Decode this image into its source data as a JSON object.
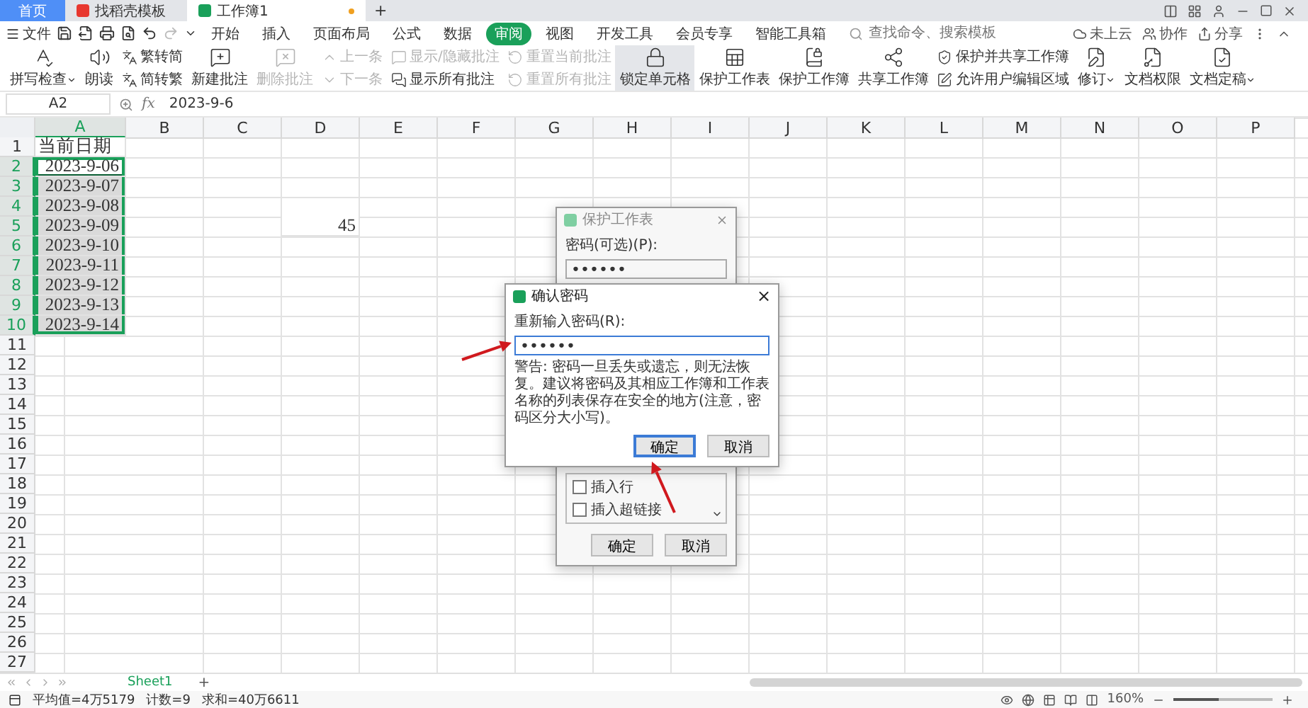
{
  "title_bar": {
    "tabs": [
      {
        "label": "首页",
        "kind": "home",
        "selected": false
      },
      {
        "label": "找稻壳模板",
        "kind": "template",
        "selected": false
      },
      {
        "label": "工作簿1",
        "kind": "sheet",
        "selected": true
      }
    ],
    "new_tab": "+"
  },
  "menu": {
    "file": "文件",
    "tabs": [
      {
        "label": "开始",
        "selected": false
      },
      {
        "label": "插入",
        "selected": false
      },
      {
        "label": "页面布局",
        "selected": false
      },
      {
        "label": "公式",
        "selected": false
      },
      {
        "label": "数据",
        "selected": false
      },
      {
        "label": "审阅",
        "selected": true
      },
      {
        "label": "视图",
        "selected": false
      },
      {
        "label": "开发工具",
        "selected": false
      },
      {
        "label": "会员专享",
        "selected": false
      },
      {
        "label": "智能工具箱",
        "selected": false
      }
    ],
    "search": {
      "placeholder": "查找命令、搜索模板"
    },
    "actions": [
      "未上云",
      "协作",
      "分享"
    ]
  },
  "ribbon": [
    {
      "kind": "large",
      "label": "拼写检查",
      "disabled": false,
      "dropdown": true,
      "selected": false
    },
    {
      "kind": "large",
      "label": "朗读",
      "disabled": false,
      "dropdown": false,
      "selected": false
    },
    {
      "kind": "stack",
      "items": [
        {
          "label": "繁转简",
          "disabled": false
        },
        {
          "label": "简转繁",
          "disabled": false
        }
      ]
    },
    {
      "kind": "large",
      "label": "新建批注",
      "disabled": false,
      "dropdown": false,
      "selected": false
    },
    {
      "kind": "large",
      "label": "删除批注",
      "disabled": true,
      "dropdown": false,
      "selected": false
    },
    {
      "kind": "stack",
      "items": [
        {
          "label": "上一条",
          "disabled": true
        },
        {
          "label": "下一条",
          "disabled": true
        }
      ]
    },
    {
      "kind": "stack",
      "items": [
        {
          "label": "显示/隐藏批注",
          "disabled": true
        },
        {
          "label": "显示所有批注",
          "disabled": false
        }
      ]
    },
    {
      "kind": "stack",
      "items": [
        {
          "label": "重置当前批注",
          "disabled": true
        },
        {
          "label": "重置所有批注",
          "disabled": true
        }
      ]
    },
    {
      "kind": "large",
      "label": "锁定单元格",
      "disabled": false,
      "dropdown": false,
      "selected": true
    },
    {
      "kind": "large",
      "label": "保护工作表",
      "disabled": false,
      "dropdown": false,
      "selected": false
    },
    {
      "kind": "large",
      "label": "保护工作簿",
      "disabled": false,
      "dropdown": false,
      "selected": false
    },
    {
      "kind": "large",
      "label": "共享工作簿",
      "disabled": false,
      "dropdown": false,
      "selected": false
    },
    {
      "kind": "stack",
      "items": [
        {
          "label": "保护并共享工作簿",
          "disabled": false
        },
        {
          "label": "允许用户编辑区域",
          "disabled": false
        }
      ]
    },
    {
      "kind": "large",
      "label": "修订",
      "disabled": false,
      "dropdown": true,
      "selected": false
    },
    {
      "kind": "large",
      "label": "文档权限",
      "disabled": false,
      "dropdown": false,
      "selected": false
    },
    {
      "kind": "large",
      "label": "文档定稿",
      "disabled": false,
      "dropdown": true,
      "selected": false
    }
  ],
  "formula_bar": {
    "name_box": "A2",
    "fx": "fx",
    "value": "2023-9-6"
  },
  "columns": [
    {
      "label": "A",
      "selected": true
    },
    {
      "label": "B",
      "selected": false
    },
    {
      "label": "C",
      "selected": false
    },
    {
      "label": "D",
      "selected": false
    },
    {
      "label": "E",
      "selected": false
    },
    {
      "label": "F",
      "selected": false
    },
    {
      "label": "G",
      "selected": false
    },
    {
      "label": "H",
      "selected": false
    },
    {
      "label": "I",
      "selected": false
    },
    {
      "label": "J",
      "selected": false
    },
    {
      "label": "K",
      "selected": false
    },
    {
      "label": "L",
      "selected": false
    },
    {
      "label": "M",
      "selected": false
    },
    {
      "label": "N",
      "selected": false
    },
    {
      "label": "O",
      "selected": false
    },
    {
      "label": "P",
      "selected": false
    }
  ],
  "rows": [
    {
      "number": "1",
      "selected": false,
      "cells": {
        "A": {
          "text": "当前日期",
          "kind": "text",
          "selected": false,
          "active": false
        }
      }
    },
    {
      "number": "2",
      "selected": true,
      "cells": {
        "A": {
          "text": "2023-9-06",
          "kind": "date",
          "selected": true,
          "active": true
        }
      }
    },
    {
      "number": "3",
      "selected": true,
      "cells": {
        "A": {
          "text": "2023-9-07",
          "kind": "date",
          "selected": true,
          "active": false
        }
      }
    },
    {
      "number": "4",
      "selected": true,
      "cells": {
        "A": {
          "text": "2023-9-08",
          "kind": "date",
          "selected": true,
          "active": false
        }
      }
    },
    {
      "number": "5",
      "selected": true,
      "cells": {
        "A": {
          "text": "2023-9-09",
          "kind": "date",
          "selected": true,
          "active": false
        },
        "D": {
          "text": "45",
          "kind": "number",
          "selected": false,
          "active": false
        }
      }
    },
    {
      "number": "6",
      "selected": true,
      "cells": {
        "A": {
          "text": "2023-9-10",
          "kind": "date",
          "selected": true,
          "active": false
        }
      }
    },
    {
      "number": "7",
      "selected": true,
      "cells": {
        "A": {
          "text": "2023-9-11",
          "kind": "date",
          "selected": true,
          "active": false
        }
      }
    },
    {
      "number": "8",
      "selected": true,
      "cells": {
        "A": {
          "text": "2023-9-12",
          "kind": "date",
          "selected": true,
          "active": false
        }
      }
    },
    {
      "number": "9",
      "selected": true,
      "cells": {
        "A": {
          "text": "2023-9-13",
          "kind": "date",
          "selected": true,
          "active": false
        }
      }
    },
    {
      "number": "10",
      "selected": true,
      "cells": {
        "A": {
          "text": "2023-9-14",
          "kind": "date",
          "selected": true,
          "active": false
        }
      }
    },
    {
      "number": "11",
      "selected": false
    },
    {
      "number": "12",
      "selected": false
    },
    {
      "number": "13",
      "selected": false
    },
    {
      "number": "14",
      "selected": false
    },
    {
      "number": "15",
      "selected": false
    },
    {
      "number": "16",
      "selected": false
    },
    {
      "number": "17",
      "selected": false
    },
    {
      "number": "18",
      "selected": false
    },
    {
      "number": "19",
      "selected": false
    },
    {
      "number": "20",
      "selected": false
    },
    {
      "number": "21",
      "selected": false
    },
    {
      "number": "22",
      "selected": false
    },
    {
      "number": "23",
      "selected": false
    },
    {
      "number": "24",
      "selected": false
    },
    {
      "number": "25",
      "selected": false
    },
    {
      "number": "26",
      "selected": false
    },
    {
      "number": "27",
      "selected": false
    }
  ],
  "protect_sheet_dialog": {
    "title": "保护工作表",
    "password_label": "密码(可选)(P):",
    "password_value": "••••••",
    "options": [
      {
        "label": "插入行",
        "checked": false
      },
      {
        "label": "插入超链接",
        "checked": false
      }
    ],
    "buttons": [
      {
        "label": "确定",
        "default": false
      },
      {
        "label": "取消",
        "default": false
      }
    ]
  },
  "confirm_password_dialog": {
    "title": "确认密码",
    "close": "×",
    "prompt": "重新输入密码(R):",
    "value": "••••••",
    "warning": "警告: 密码一旦丢失或遗忘，则无法恢复。建议将密码及其相应工作簿和工作表名称的列表保存在安全的地方(注意，密码区分大小写)。",
    "buttons": [
      {
        "label": "确定",
        "default": true
      },
      {
        "label": "取消",
        "default": false
      }
    ]
  },
  "sheet_tabs": {
    "tabs": [
      {
        "label": "Sheet1",
        "selected": true
      }
    ],
    "add": "+"
  },
  "status_bar": {
    "stats": [
      "平均值=4万5179",
      "计数=9",
      "求和=40万6611"
    ],
    "zoom": "160%",
    "zoom_slider": {
      "level": 0.45
    }
  }
}
